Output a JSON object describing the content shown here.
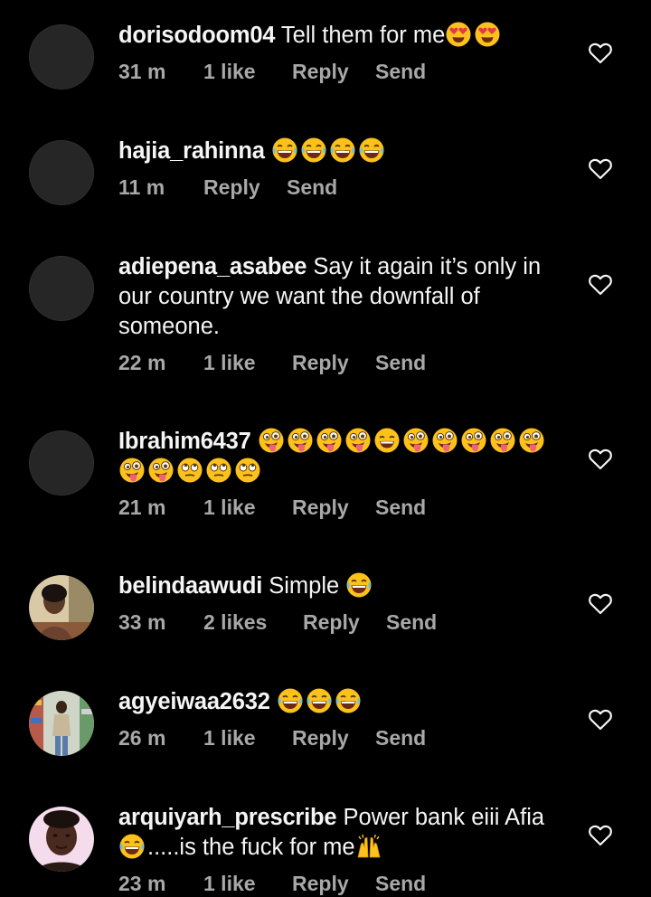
{
  "comments": [
    {
      "username": "dorisodoom04",
      "text": "Tell them for me",
      "emojis": [
        "heart-eyes-emoji",
        "heart-eyes-emoji"
      ],
      "time": "31 m",
      "likes": "1 like",
      "reply": "Reply",
      "send": "Send"
    },
    {
      "username": "hajia_rahinna",
      "text": "",
      "emojis": [
        "laughing-emoji",
        "laughing-emoji",
        "laughing-emoji",
        "laughing-emoji"
      ],
      "time": "11 m",
      "likes": "",
      "reply": "Reply",
      "send": "Send"
    },
    {
      "username": "adiepena_asabee",
      "text": "Say it again it’s only in our country we want the downfall of someone.",
      "emojis": [],
      "time": "22 m",
      "likes": "1 like",
      "reply": "Reply",
      "send": "Send"
    },
    {
      "username": "Ibrahim6437",
      "text": "",
      "emojis": [
        "tongue-wink-emoji",
        "tongue-wink-emoji",
        "tongue-wink-emoji",
        "tongue-wink-emoji",
        "grin-emoji",
        "tongue-wink-emoji",
        "tongue-wink-emoji",
        "tongue-wink-emoji",
        "tongue-wink-emoji",
        "tongue-wink-emoji",
        "tongue-wink-emoji",
        "tongue-wink-emoji",
        "eye-roll-emoji",
        "eye-roll-emoji",
        "eye-roll-emoji"
      ],
      "time": "21 m",
      "likes": "1 like",
      "reply": "Reply",
      "send": "Send"
    },
    {
      "username": "belindaawudi",
      "text": "Simple",
      "emojis": [
        "laughing-emoji"
      ],
      "time": "33 m",
      "likes": "2 likes",
      "reply": "Reply",
      "send": "Send"
    },
    {
      "username": "agyeiwaa2632",
      "text": "",
      "emojis": [
        "laughing-emoji",
        "laughing-emoji",
        "laughing-emoji"
      ],
      "time": "26 m",
      "likes": "1 like",
      "reply": "Reply",
      "send": "Send"
    },
    {
      "username": "arquiyarh_prescribe",
      "text": "Power bank eiii Afia",
      "after_emoji_text": ".....is the fuck for me",
      "emojis": [
        "laughing-emoji"
      ],
      "trailing_emojis": [
        "raising-hands-emoji"
      ],
      "time": "23 m",
      "likes": "1 like",
      "reply": "Reply",
      "send": "Send"
    }
  ],
  "colors": {
    "background": "#000000",
    "primary_text": "#f5f5f5",
    "secondary_text": "#a8a8a8",
    "blank_avatar": "#262626"
  },
  "icons": {
    "like": "heart-outline-icon"
  }
}
